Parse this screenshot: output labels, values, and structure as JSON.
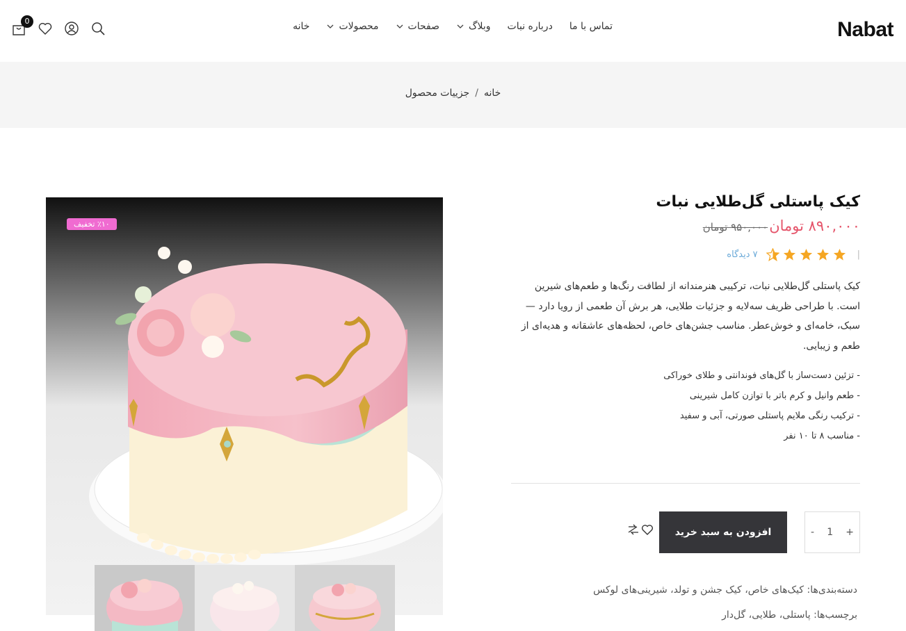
{
  "header": {
    "logo": "Nabat",
    "cart_count": "0",
    "nav": [
      {
        "label": "خانه",
        "dropdown": false
      },
      {
        "label": "محصولات",
        "dropdown": true
      },
      {
        "label": "صفحات",
        "dropdown": true
      },
      {
        "label": "وبلاگ",
        "dropdown": true
      },
      {
        "label": "درباره نبات",
        "dropdown": false
      },
      {
        "label": "تماس با ما",
        "dropdown": false
      }
    ]
  },
  "breadcrumb": {
    "home": "خانه",
    "separator": "/",
    "current": "جزییات محصول"
  },
  "product": {
    "badge": "٪۱۰ تخفیف",
    "title": "کیک پاستلی گل‌طلایی نبات",
    "price_new": "۸۹۰,۰۰۰ تومان",
    "price_old": "۹۵۰,۰۰۰ تومان",
    "rating": 4.5,
    "views": "۷ دیدگاه",
    "description": "کیک پاستلی گل‌طلایی نبات، ترکیبی هنرمندانه از لطافت رنگ‌ها و طعم‌های شیرین است. با طراحی ظریف سه‌لایه و جزئیات طلایی، هر برش آن طعمی از رویا دارد — سبک، خامه‌ای و خوش‌عطر. مناسب جشن‌های خاص، لحظه‌های عاشقانه و هدیه‌ای از طعم و زیبایی.",
    "features": [
      "- تزئین دست‌ساز با گل‌های فوندانتی و طلای خوراکی",
      "- طعم وانیل و کرم باتر با توازن کامل شیرینی",
      "- ترکیب رنگی ملایم پاستلی صورتی، آبی و سفید",
      "- مناسب ۸ تا ۱۰ نفر"
    ],
    "quantity": "1",
    "qty_plus": "+",
    "qty_minus": "-",
    "add_to_cart": "افزودن به سبد خرید",
    "categories_label": "دسته‌بندی‌ها:",
    "categories": "کیک‌های خاص،  کیک جشن و تولد،  شیرینی‌های لوکس",
    "tags_label": "برچسب‌ها:",
    "tags": "پاستلی،  طلایی،  گل‌دار"
  },
  "colors": {
    "accent_price": "#e5546a",
    "badge": "#f06bd1",
    "button": "#353539",
    "views": "#6aa9d8",
    "star": "#f5a623"
  }
}
